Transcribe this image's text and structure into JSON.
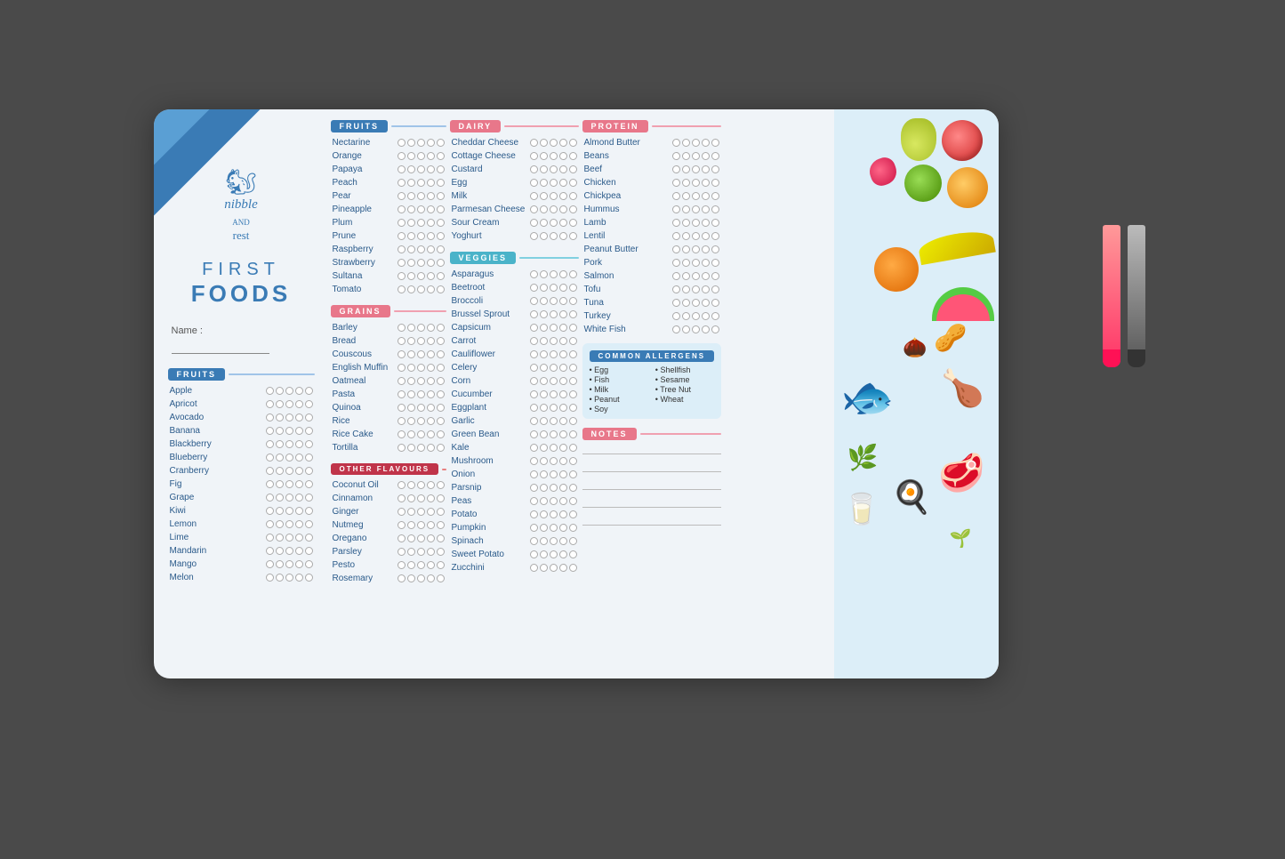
{
  "card": {
    "title": "FIRST FOODS",
    "title_first": "FIRST",
    "title_foods": "FOODS",
    "name_label": "Name :",
    "logo_nibble": "nibble",
    "logo_and": "AND",
    "logo_rest": "rest"
  },
  "left_fruits": {
    "header": "FRUITS",
    "items": [
      "Apple",
      "Apricot",
      "Avocado",
      "Banana",
      "Blackberry",
      "Blueberry",
      "Cranberry",
      "Fig",
      "Grape",
      "Kiwi",
      "Lemon",
      "Lime",
      "Mandarin",
      "Mango",
      "Melon"
    ]
  },
  "fruits": {
    "header": "FRUITS",
    "items": [
      "Nectarine",
      "Orange",
      "Papaya",
      "Peach",
      "Pear",
      "Pineapple",
      "Plum",
      "Prune",
      "Raspberry",
      "Strawberry",
      "Sultana",
      "Tomato"
    ]
  },
  "grains": {
    "header": "GRAINS",
    "items": [
      "Barley",
      "Bread",
      "Couscous",
      "English Muffin",
      "Oatmeal",
      "Pasta",
      "Quinoa",
      "Rice",
      "Rice Cake",
      "Tortilla"
    ]
  },
  "other_flavours": {
    "header": "OTHER FLAVOURS",
    "items": [
      "Coconut Oil",
      "Cinnamon",
      "Ginger",
      "Nutmeg",
      "Oregano",
      "Parsley",
      "Pesto",
      "Rosemary"
    ]
  },
  "dairy": {
    "header": "DAIRY",
    "items": [
      "Cheddar Cheese",
      "Cottage Cheese",
      "Custard",
      "Egg",
      "Milk",
      "Parmesan Cheese",
      "Sour Cream",
      "Yoghurt"
    ]
  },
  "veggies": {
    "header": "VEGGIES",
    "items": [
      "Asparagus",
      "Beetroot",
      "Broccoli",
      "Brussel Sprout",
      "Capsicum",
      "Carrot",
      "Cauliflower",
      "Celery",
      "Corn",
      "Cucumber",
      "Eggplant",
      "Garlic",
      "Green Bean",
      "Kale",
      "Mushroom",
      "Onion",
      "Parsnip",
      "Peas",
      "Potato",
      "Pumpkin",
      "Spinach",
      "Sweet Potato",
      "Zucchini"
    ]
  },
  "protein": {
    "header": "PROTEIN",
    "items": [
      "Almond Butter",
      "Beans",
      "Beef",
      "Chicken",
      "Chickpea",
      "Hummus",
      "Lamb",
      "Lentil",
      "Peanut Butter",
      "Pork",
      "Salmon",
      "Tofu",
      "Tuna",
      "Turkey",
      "White Fish"
    ]
  },
  "allergens": {
    "header": "COMMON ALLERGENS",
    "col1": [
      "• Egg",
      "• Fish",
      "• Milk",
      "• Peanut",
      "• Soy"
    ],
    "col2": [
      "• Shellfish",
      "• Sesame",
      "• Tree Nut",
      "• Wheat"
    ]
  },
  "notes": {
    "header": "NOTES"
  },
  "circles_count": 5
}
